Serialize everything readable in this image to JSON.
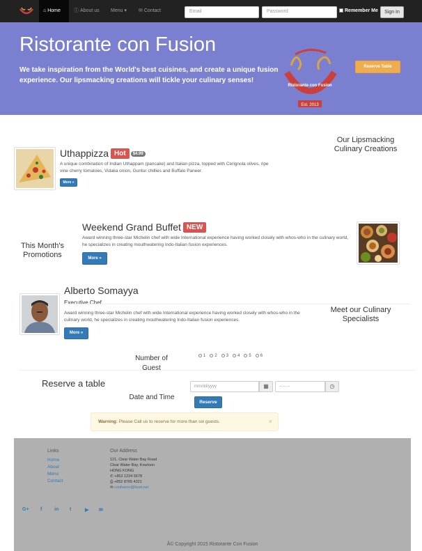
{
  "navbar": {
    "items": [
      {
        "label": "Home",
        "icon": "home-icon"
      },
      {
        "label": "About us",
        "icon": "info-icon"
      },
      {
        "label": "Menu ▾",
        "icon": ""
      },
      {
        "label": "Contact",
        "icon": "envelope-icon"
      }
    ],
    "email_placeholder": "Email",
    "password_placeholder": "Password",
    "remember_label": "Remember Me",
    "signin_label": "Sign In"
  },
  "jumbotron": {
    "title": "Ristorante con Fusion",
    "tagline": "We take inspiration from the World's best cuisines, and create a unique fusion experience. Our lipsmacking creations will tickle your culinary senses!",
    "logo_text": "Ristorante con Fusion",
    "logo_est": "Est. 2013",
    "reserve_button": "Reserve Table",
    "bg_color": "#7a7fd0"
  },
  "dish": {
    "name": "Uthappizza",
    "label": "Hot",
    "price": "$4.99",
    "description": "A unique combination of Indian Uthappam (pancake) and Italian pizza, topped with Cerignola olives, ripe vine cherry tomatoes, Vidalia onion, Guntur chillies and Buffalo Paneer.",
    "more": "More »",
    "side_heading": "Our Lipsmacking Culinary Creations"
  },
  "promotion": {
    "name": "Weekend Grand Buffet",
    "label": "NEW",
    "description": "Award winning three-star Michelin chef with wide International experience having worked closely with whos-who in the culinary world, he specializes in creating mouthwatering Indo-Italian fusion experiences.",
    "more": "More »",
    "side_heading": "This Month's Promotions"
  },
  "leader": {
    "name": "Alberto Somayya",
    "designation": "Executive Chef",
    "description": "Award winning three-star Michelin chef with wide International experience having worked closely with whos-who in the culinary world, he specializes in creating mouthwatering Indo-Italian fusion experiences.",
    "more": "More »",
    "side_heading": "Meet our Culinary Specialists"
  },
  "reservation": {
    "guests_label": "Number of Guest",
    "guest_options": [
      "1",
      "2",
      "3",
      "4",
      "5",
      "6"
    ],
    "heading": "Reserve a table",
    "datetime_label": "Date and Time",
    "date_placeholder": "mm/dd/yyyy",
    "time_placeholder": "--:-- --",
    "reserve_button": "Reserve",
    "alert_strong": "Warning:",
    "alert_text": "Please Call us to reserve for more than six guests.",
    "alert_close": "×"
  },
  "footer": {
    "links_heading": "Links",
    "links": [
      "Home",
      "About",
      "Menu",
      "Contact"
    ],
    "address_heading": "Our Address",
    "address_lines": [
      "121, Clear Water Bay Road",
      "Clear Water Bay, Kowloon",
      "HONG KONG"
    ],
    "phone": "+852 1234 5678",
    "fax": "+852 8765 4321",
    "email": "confusion@food.net",
    "social": [
      "G+",
      "f",
      "in",
      "t",
      "▶",
      "✉"
    ],
    "copyright": "Â© Copyright 2015 Ristorante Con Fusion"
  }
}
